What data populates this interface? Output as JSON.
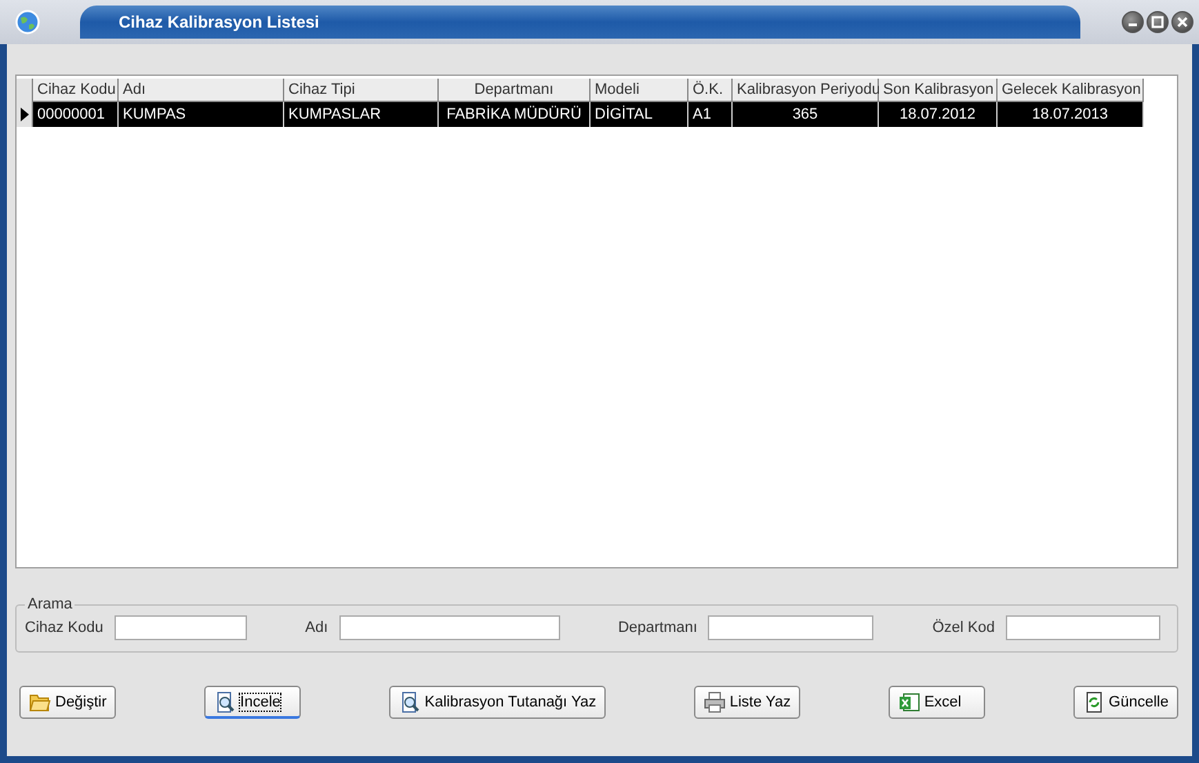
{
  "window": {
    "title": "Cihaz Kalibrasyon Listesi"
  },
  "table": {
    "columns": [
      {
        "label": "Cihaz Kodu"
      },
      {
        "label": "Adı"
      },
      {
        "label": "Cihaz Tipi"
      },
      {
        "label": "Departmanı"
      },
      {
        "label": "Modeli"
      },
      {
        "label": "Ö.K."
      },
      {
        "label": "Kalibrasyon Periyodu"
      },
      {
        "label": "Son Kalibrasyon"
      },
      {
        "label": "Gelecek Kalibrasyon"
      }
    ],
    "rows": [
      {
        "selected": true,
        "cells": [
          "00000001",
          "KUMPAS",
          "KUMPASLAR",
          "FABRİKA MÜDÜRÜ",
          "DİGİTAL",
          "A1",
          "365",
          "18.07.2012",
          "18.07.2013"
        ]
      }
    ]
  },
  "search": {
    "title": "Arama",
    "fields": [
      {
        "label": "Cihaz Kodu"
      },
      {
        "label": "Adı"
      },
      {
        "label": "Departmanı"
      },
      {
        "label": "Özel Kod"
      }
    ]
  },
  "buttons": [
    {
      "label": "Değiştir",
      "kind": "folder",
      "focused": false
    },
    {
      "label": "İncele",
      "kind": "document",
      "focused": true
    },
    {
      "label": "Kalibrasyon Tutanağı Yaz",
      "kind": "document",
      "focused": false
    },
    {
      "label": "Liste Yaz",
      "kind": "printer",
      "focused": false
    },
    {
      "label": "Excel",
      "kind": "excel",
      "focused": false
    },
    {
      "label": "Güncelle",
      "kind": "refresh",
      "focused": false
    }
  ]
}
